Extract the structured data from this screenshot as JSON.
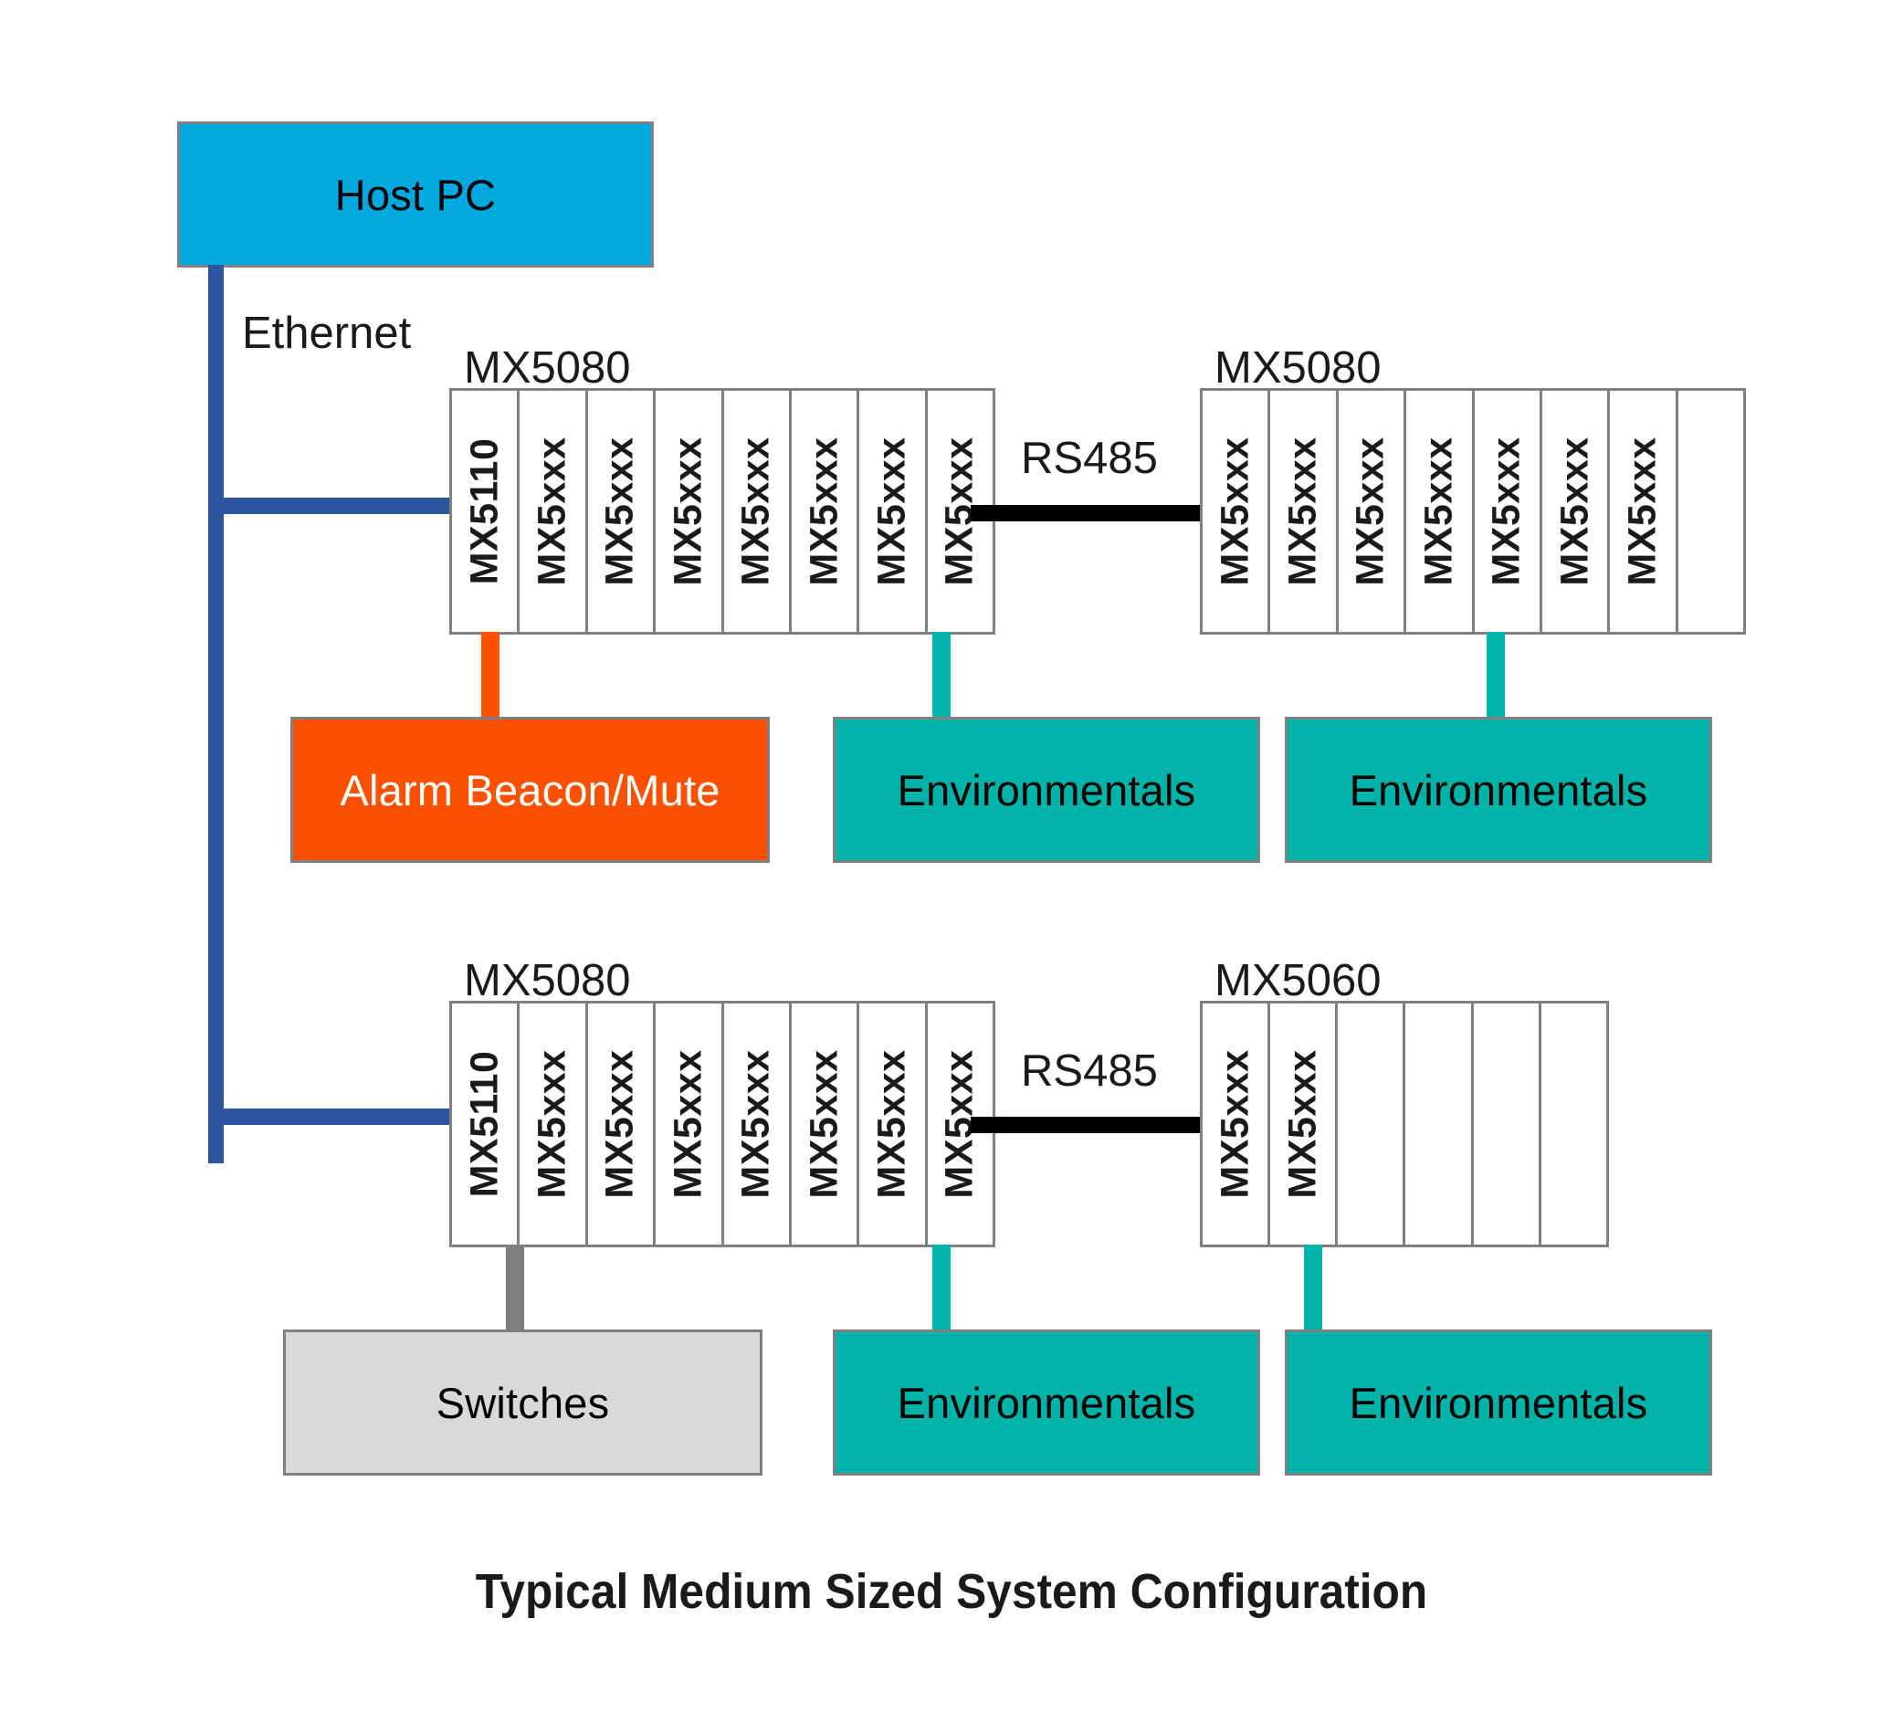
{
  "diagram": {
    "title": "Typical Medium Sized System Configuration",
    "colors": {
      "host_pc": "#00A8E0",
      "ethernet": "#2C55A0",
      "rs485": "#000000",
      "alarm": "#FB5000",
      "environmentals": "#00B3A8",
      "switches": "#D9D9D9",
      "chassis_border": "#808080"
    }
  },
  "nodes": {
    "host_pc": {
      "label": "Host PC"
    },
    "alarm_beacon": {
      "label": "Alarm Beacon/Mute"
    },
    "switches": {
      "label": "Switches"
    },
    "environmentals_top_left": {
      "label": "Environmentals"
    },
    "environmentals_top_right": {
      "label": "Environmentals"
    },
    "environmentals_bottom_left": {
      "label": "Environmentals"
    },
    "environmentals_bottom_right": {
      "label": "Environmentals"
    }
  },
  "links": {
    "ethernet": {
      "label": "Ethernet"
    },
    "rs485_top": {
      "label": "RS485"
    },
    "rs485_bottom": {
      "label": "RS485"
    }
  },
  "chassis": [
    {
      "id": "top-left",
      "caption": "MX5080",
      "slot_count": 8,
      "slots": [
        {
          "label": "MX5110",
          "empty": false
        },
        {
          "label": "MX5xxx",
          "empty": false
        },
        {
          "label": "MX5xxx",
          "empty": false
        },
        {
          "label": "MX5xxx",
          "empty": false
        },
        {
          "label": "MX5xxx",
          "empty": false
        },
        {
          "label": "MX5xxx",
          "empty": false
        },
        {
          "label": "MX5xxx",
          "empty": false
        },
        {
          "label": "MX5xxx",
          "empty": false
        }
      ]
    },
    {
      "id": "top-right",
      "caption": "MX5080",
      "slot_count": 8,
      "slots": [
        {
          "label": "MX5xxx",
          "empty": false
        },
        {
          "label": "MX5xxx",
          "empty": false
        },
        {
          "label": "MX5xxx",
          "empty": false
        },
        {
          "label": "MX5xxx",
          "empty": false
        },
        {
          "label": "MX5xxx",
          "empty": false
        },
        {
          "label": "MX5xxx",
          "empty": false
        },
        {
          "label": "MX5xxx",
          "empty": false
        },
        {
          "label": "",
          "empty": true
        }
      ]
    },
    {
      "id": "bottom-left",
      "caption": "MX5080",
      "slot_count": 8,
      "slots": [
        {
          "label": "MX5110",
          "empty": false
        },
        {
          "label": "MX5xxx",
          "empty": false
        },
        {
          "label": "MX5xxx",
          "empty": false
        },
        {
          "label": "MX5xxx",
          "empty": false
        },
        {
          "label": "MX5xxx",
          "empty": false
        },
        {
          "label": "MX5xxx",
          "empty": false
        },
        {
          "label": "MX5xxx",
          "empty": false
        },
        {
          "label": "MX5xxx",
          "empty": false
        }
      ]
    },
    {
      "id": "bottom-right",
      "caption": "MX5060",
      "slot_count": 6,
      "slots": [
        {
          "label": "MX5xxx",
          "empty": false
        },
        {
          "label": "MX5xxx",
          "empty": false
        },
        {
          "label": "",
          "empty": true
        },
        {
          "label": "",
          "empty": true
        },
        {
          "label": "",
          "empty": true
        },
        {
          "label": "",
          "empty": true
        }
      ]
    }
  ]
}
